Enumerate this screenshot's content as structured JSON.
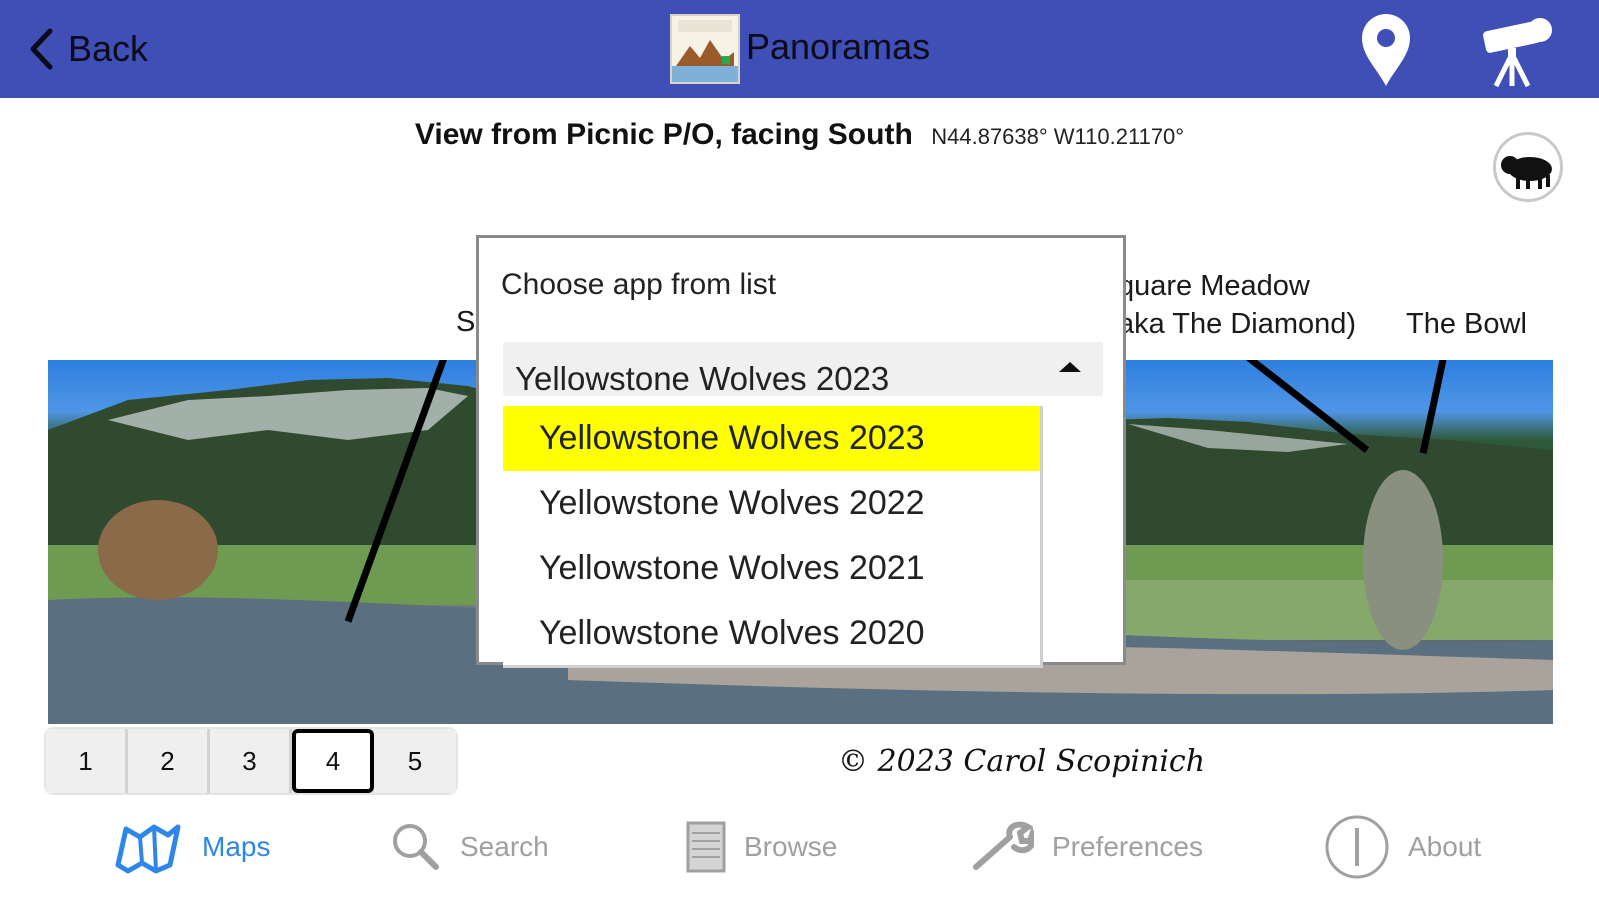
{
  "header": {
    "back_label": "Back",
    "title": "Panoramas"
  },
  "view": {
    "title": "View from Picnic P/O, facing South",
    "coordinates": "N44.87638° W110.21170°"
  },
  "panorama_labels": {
    "partial_left": "S",
    "square_meadow_line1": "quare Meadow",
    "square_meadow_line2": "aka The Diamond)",
    "the_bowl": "The Bowl"
  },
  "dialog": {
    "prompt": "Choose app from list",
    "selected_value": "Yellowstone Wolves 2023",
    "options": [
      "Yellowstone Wolves 2023",
      "Yellowstone Wolves 2022",
      "Yellowstone Wolves 2021",
      "Yellowstone Wolves 2020"
    ],
    "highlight_color": "#ffff00"
  },
  "pages": [
    "1",
    "2",
    "3",
    "4",
    "5"
  ],
  "active_page": "4",
  "copyright": "© 2023 Carol Scopinich",
  "tabs": [
    {
      "label": "Maps",
      "icon": "map-icon",
      "active": true
    },
    {
      "label": "Search",
      "icon": "search-icon",
      "active": false
    },
    {
      "label": "Browse",
      "icon": "browse-icon",
      "active": false
    },
    {
      "label": "Preferences",
      "icon": "wrench-icon",
      "active": false
    },
    {
      "label": "About",
      "icon": "info-icon",
      "active": false
    }
  ],
  "colors": {
    "header_bg": "#3f4fb5",
    "tab_active": "#2e86e8",
    "tab_inactive": "#a0a0a0"
  }
}
